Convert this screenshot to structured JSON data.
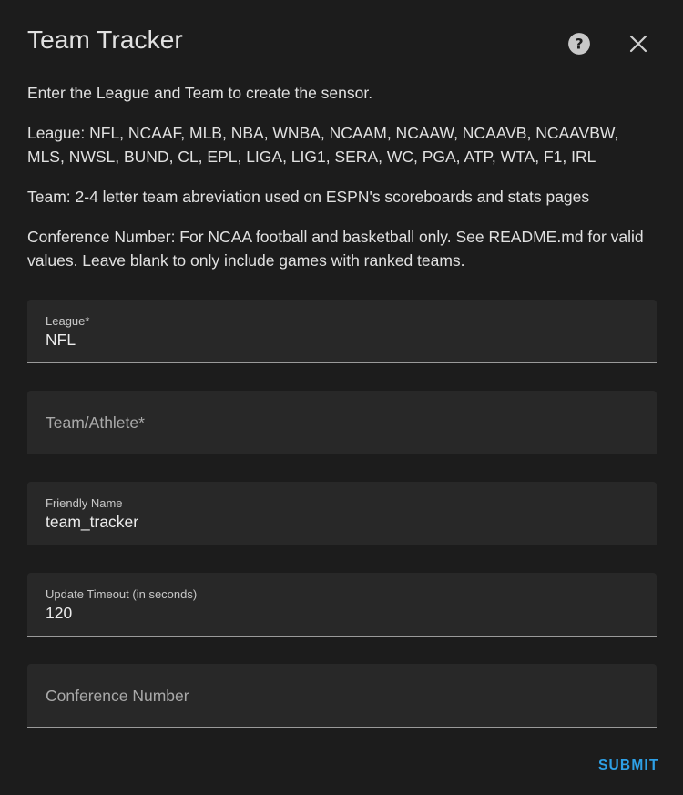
{
  "dialog": {
    "title": "Team Tracker"
  },
  "description": {
    "intro": "Enter the League and Team to create the sensor.",
    "league": "League: NFL, NCAAF, MLB, NBA, WNBA, NCAAM, NCAAW, NCAAVB, NCAAVBW, MLS, NWSL, BUND, CL, EPL, LIGA, LIG1, SERA, WC, PGA, ATP, WTA, F1, IRL",
    "team": "Team: 2-4 letter team abreviation used on ESPN's scoreboards and stats pages",
    "conference": "Conference Number: For NCAA football and basketball only. See README.md for valid values. Leave blank to only include games with ranked teams."
  },
  "fields": {
    "league": {
      "label": "League*",
      "value": "NFL"
    },
    "team": {
      "placeholder": "Team/Athlete*"
    },
    "friendly_name": {
      "label": "Friendly Name",
      "value": "team_tracker"
    },
    "timeout": {
      "label": "Update Timeout (in seconds)",
      "value": "120"
    },
    "conference": {
      "placeholder": "Conference Number"
    }
  },
  "actions": {
    "submit_label": "SUBMIT"
  },
  "icons": {
    "help": "help-icon",
    "close": "close-icon"
  },
  "colors": {
    "background": "#1c1c1c",
    "field_background": "#282828",
    "accent": "#2ea0e6"
  }
}
